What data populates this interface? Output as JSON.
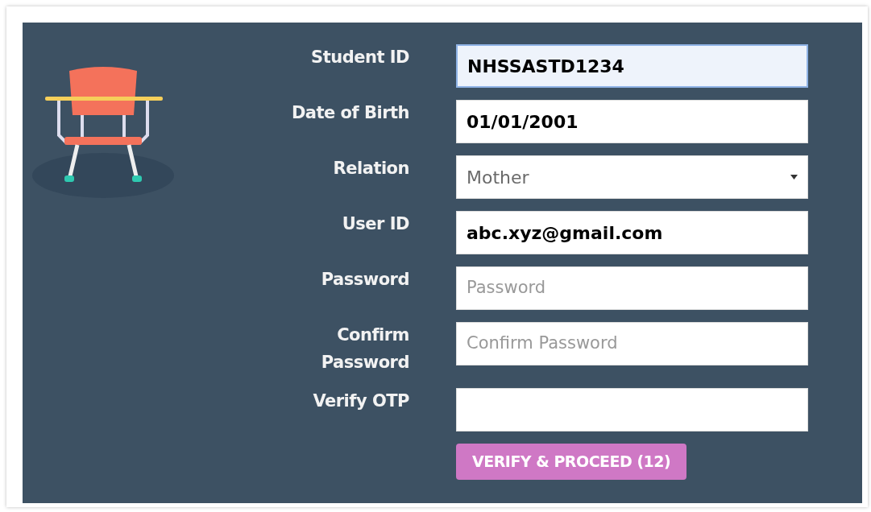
{
  "fields": [
    {
      "label": "Student ID",
      "kind": "text",
      "value": "NHSSASTD1234",
      "focused": true
    },
    {
      "label": "Date of Birth",
      "kind": "text",
      "value": "01/01/2001",
      "focused": false
    },
    {
      "label": "Relation",
      "kind": "select",
      "value": "Mother",
      "focused": false
    },
    {
      "label": "User ID",
      "kind": "text",
      "value": "abc.xyz@gmail.com",
      "focused": false
    },
    {
      "label": "Password",
      "kind": "password",
      "placeholder": "Password",
      "focused": false
    },
    {
      "label": "Confirm Password",
      "kind": "password",
      "placeholder": "Confirm Password",
      "focused": false
    },
    {
      "label": "Verify OTP",
      "kind": "text",
      "focused": false
    }
  ],
  "button": {
    "label": "VERIFY & PROCEED (12)"
  }
}
